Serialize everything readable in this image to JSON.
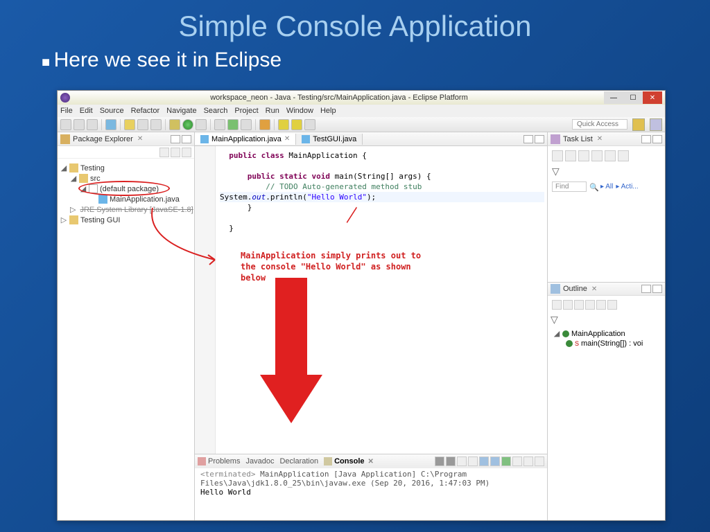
{
  "slide": {
    "title": "Simple Console Application",
    "bullet": "Here we see it in Eclipse"
  },
  "window": {
    "title": "workspace_neon - Java - Testing/src/MainApplication.java - Eclipse Platform",
    "quick_access": "Quick Access"
  },
  "menu": {
    "file": "File",
    "edit": "Edit",
    "source": "Source",
    "refactor": "Refactor",
    "navigate": "Navigate",
    "search": "Search",
    "project": "Project",
    "run": "Run",
    "window": "Window",
    "help": "Help"
  },
  "package_explorer": {
    "title": "Package Explorer",
    "tree": {
      "testing": "Testing",
      "src": "src",
      "default_pkg": "(default package)",
      "main_app": "MainApplication.java",
      "jre": "JRE System Library [JavaSE-1.8]",
      "testing_gui": "Testing GUI"
    }
  },
  "editor": {
    "tab1": "MainApplication.java",
    "tab2": "TestGUI.java",
    "code": {
      "l1a": "public class ",
      "l1b": "MainApplication {",
      "l2a": "public static void ",
      "l2b": "main(String[] args) {",
      "l3": "// TODO Auto-generated method stub",
      "l4a": "System.",
      "l4b": "out",
      "l4c": ".println(",
      "l4d": "\"Hello World\"",
      "l4e": ");",
      "l5": "}",
      "l6": "}"
    }
  },
  "annotation": {
    "text": "MainApplication simply prints out to the console \"Hello World\" as shown below"
  },
  "task_list": {
    "title": "Task List",
    "find": "Find",
    "all": "All",
    "activate": "Acti..."
  },
  "outline": {
    "title": "Outline",
    "class": "MainApplication",
    "method": "main(String[]) : voi"
  },
  "bottom": {
    "problems": "Problems",
    "javadoc": "Javadoc",
    "declaration": "Declaration",
    "console": "Console",
    "header_a": "<terminated>",
    "header_b": " MainApplication [Java Application] C:\\Program Files\\Java\\jdk1.8.0_25\\bin\\javaw.exe (Sep 20, 2016, 1:47:03 PM)",
    "output": "Hello World"
  }
}
